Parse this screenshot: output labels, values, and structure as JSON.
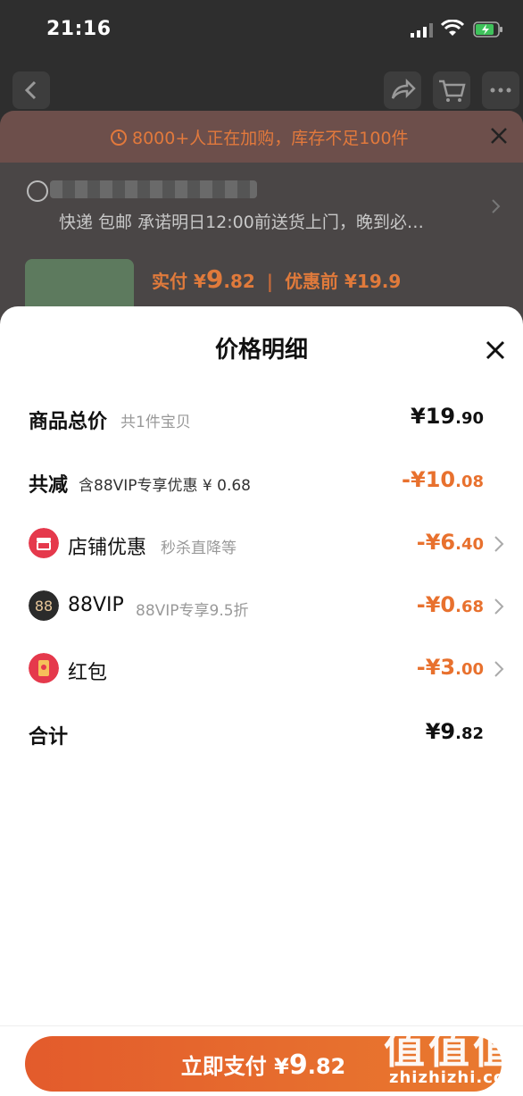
{
  "status_bar": {
    "time": "21:16"
  },
  "notice": {
    "text": "8000+人正在加购，库存不足100件"
  },
  "delivery": {
    "text": "快递 包邮 承诺明日12:00前送货上门，晚到必…"
  },
  "product": {
    "price_label": "实付 ¥",
    "price_int": "9",
    "price_dec": ".82",
    "before_label": "优惠前 ¥19.9"
  },
  "sheet": {
    "title": "价格明细",
    "rows": [
      {
        "label": "商品总价",
        "sub": "共1件宝贝",
        "amount_int": "¥19",
        "amount_dec": ".90"
      },
      {
        "label": "共减",
        "sub": "含88VIP专享优惠 ¥ 0.68",
        "amount_int": "-¥10",
        "amount_dec": ".08"
      },
      {
        "label": "店铺优惠",
        "sub": "秒杀直降等",
        "amount_int": "-¥6",
        "amount_dec": ".40",
        "icon": "shop-icon"
      },
      {
        "label": "88VIP",
        "sub": "88VIP专享9.5折",
        "amount_int": "-¥0",
        "amount_dec": ".68",
        "icon": "vip-88-icon"
      },
      {
        "label": "红包",
        "sub": "",
        "amount_int": "-¥3",
        "amount_dec": ".00",
        "icon": "red-packet-icon"
      },
      {
        "label": "合计",
        "sub": "",
        "amount_int": "¥9",
        "amount_dec": ".82"
      }
    ]
  },
  "pay_button": {
    "label": "立即支付 ¥",
    "amount_int": "9",
    "amount_dec": ".82"
  },
  "watermark": {
    "logo": "值值值",
    "url": "zhizhizhi.com"
  },
  "colors": {
    "accent": "#e8712e",
    "button_start": "#e35b2c",
    "button_end": "#e97a2f",
    "vip_icon": "#2b2b2b",
    "shop_icon": "#e5394c"
  }
}
